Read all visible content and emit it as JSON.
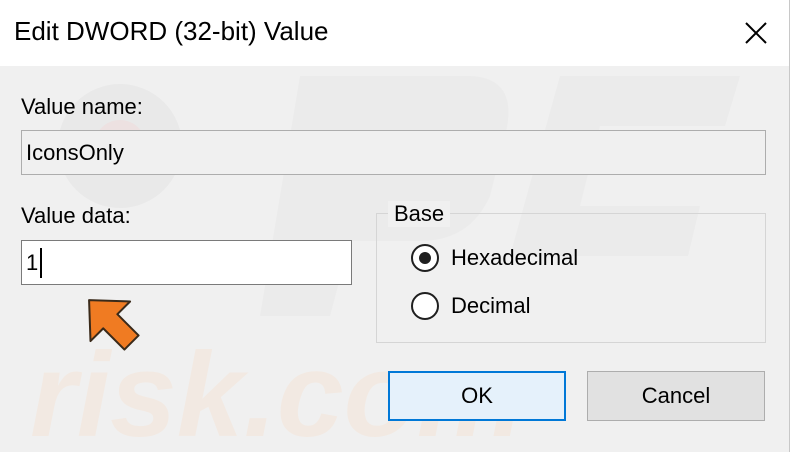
{
  "window": {
    "title": "Edit DWORD (32-bit) Value",
    "close_icon": "close-icon"
  },
  "value_name": {
    "label": "Value name:",
    "value": "IconsOnly"
  },
  "value_data": {
    "label": "Value data:",
    "value": "1"
  },
  "base": {
    "label": "Base",
    "options": [
      {
        "label": "Hexadecimal",
        "selected": true
      },
      {
        "label": "Decimal",
        "selected": false
      }
    ]
  },
  "buttons": {
    "ok_label": "OK",
    "cancel_label": "Cancel"
  },
  "watermark": {
    "text": "risk.com"
  },
  "colors": {
    "accent": "#0078d7",
    "arrow": "#f07b22",
    "dialog_bg": "#f0f0f0"
  },
  "annotation_icon": "orange-arrow-icon"
}
